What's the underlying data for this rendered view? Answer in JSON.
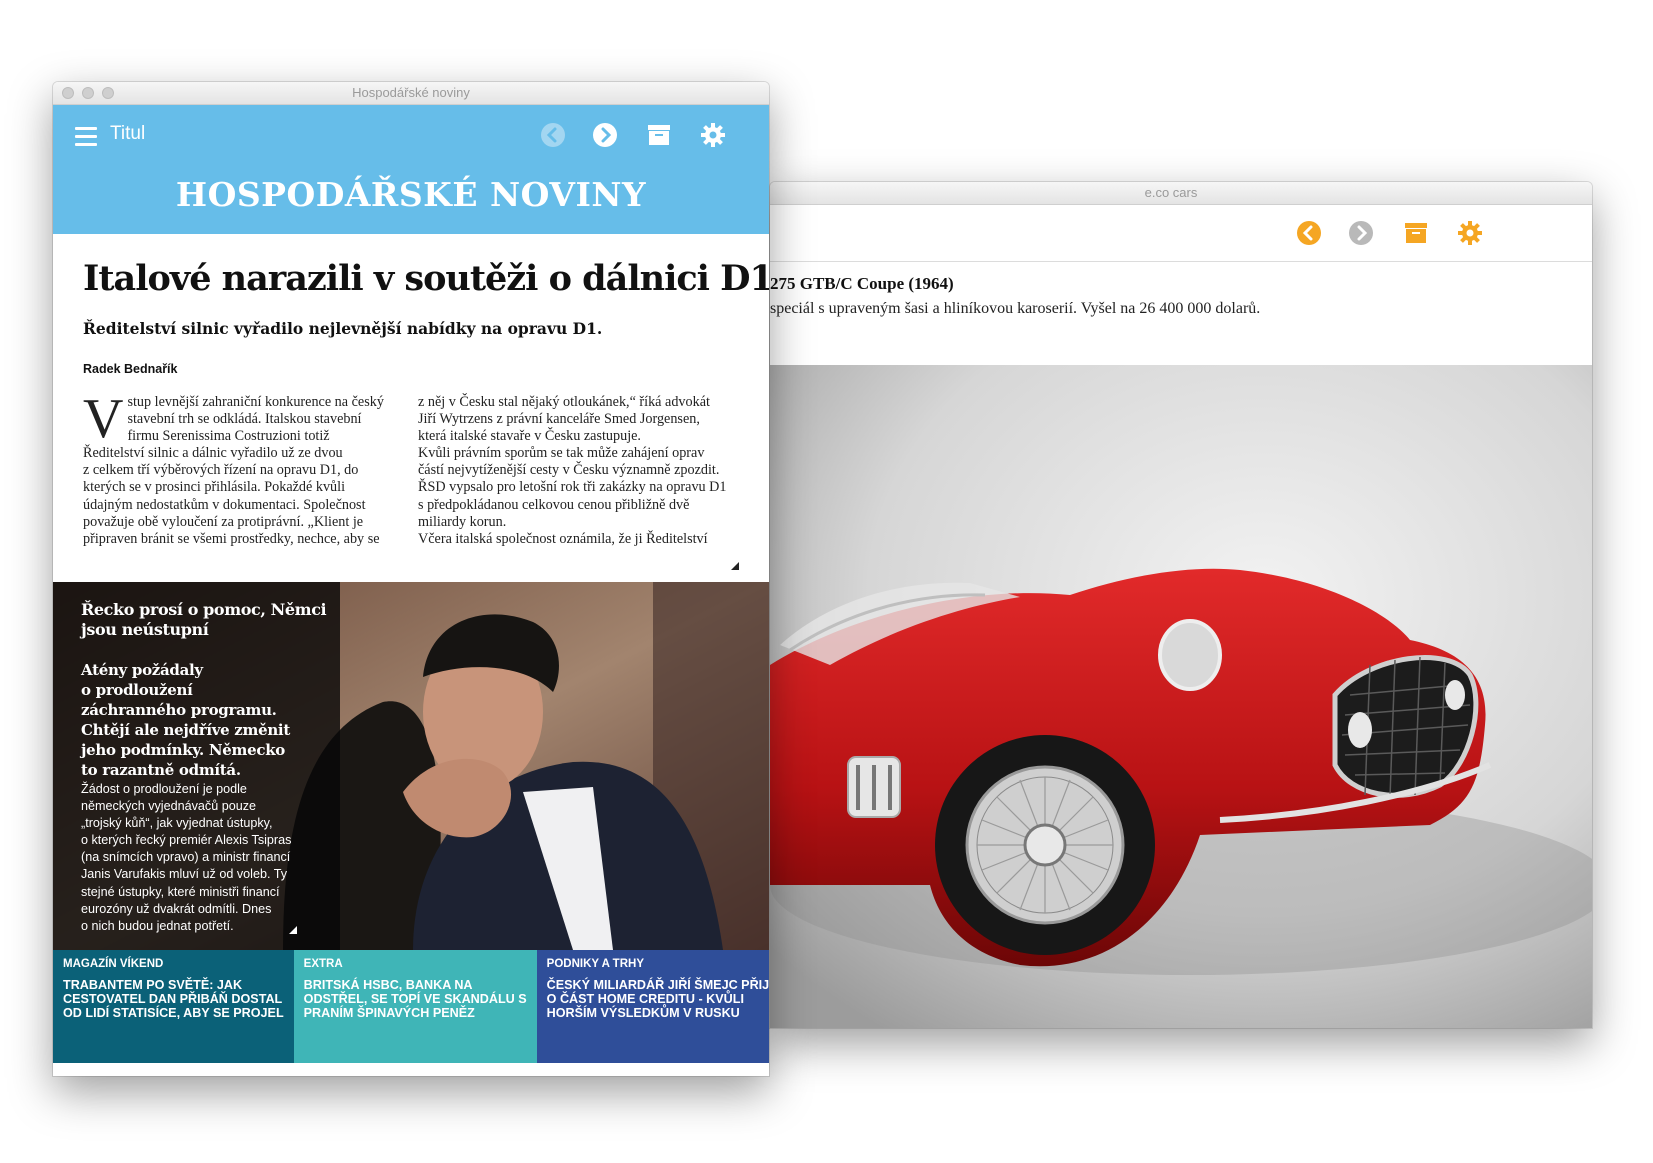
{
  "back_window": {
    "title": "e.co cars",
    "toolbar": {
      "back_icon": "chevron-left-circle-icon",
      "forward_icon": "chevron-right-circle-icon",
      "archive_icon": "archive-icon",
      "settings_icon": "gear-icon",
      "accent": "#f5a623"
    },
    "car_title": "275 GTB/C Coupe (1964)",
    "car_description": "speciál s upraveným šasi a hliníkovou karoserií. Vyšel na 26 400 000 dolarů."
  },
  "front_window": {
    "title": "Hospodářské noviny",
    "header": {
      "menu_label": "Titul",
      "masthead": "HOSPODÁŘSKÉ NOVINY",
      "bg_color": "#66bde9"
    },
    "article": {
      "headline": "Italové narazili v soutěži o dálnici D1",
      "subhead": "Ředitelství silnic vyřadilo nejlevnější nabídky na opravu D1.",
      "author": "Radek Bednařík",
      "dropcap": "V",
      "col1_lines": [
        "stup levnější zahraniční konkurence na český",
        "stavební trh se odkládá. Italskou stavební",
        "firmu Serenissima Costruzioni totiž",
        "Ředitelství silnic a dálnic vyřadilo už ze dvou",
        "z celkem tří výběrových řízení na opravu D1, do",
        "kterých se v prosinci přihlásila. Pokaždé kvůli",
        "údajným nedostatkům v dokumentaci. Společnost",
        "považuje obě vyloučení za protiprávní. „Klient je",
        "připraven bránit se všemi prostředky, nechce, aby se"
      ],
      "col2_lines": [
        "z něj v Česku stal nějaký otloukánek,“ říká advokát",
        "Jiří Wytrzens z právní kanceláře Smed Jorgensen,",
        "která italské stavaře v Česku zastupuje.",
        "Kvůli právním sporům se tak může zahájení oprav",
        "částí nejvytíženější cesty v Česku významně zpozdit.",
        "ŘSD vypsalo pro letošní rok tři zakázky na opravu D1",
        "s předpokládanou celkovou cenou přibližně dvě",
        "miliardy korun.",
        "Včera italská společnost oznámila, že ji Ředitelství"
      ]
    },
    "feature": {
      "title_lines": [
        "Řecko prosí o pomoc, Němci",
        "jsou neústupní"
      ],
      "lead_lines": [
        "Atény požádaly",
        "o prodloužení",
        "záchranného programu.",
        "Chtějí ale nejdříve změnit",
        "jeho podmínky. Německo",
        "to razantně odmítá."
      ],
      "body_lines": [
        "Žádost o prodloužení je podle",
        "německých vyjednávačů pouze",
        "„trojský kůň“, jak vyjednat ústupky,",
        "o kterých řecký premiér Alexis Tsipras",
        "(na snímcích vpravo) a ministr financí",
        "Janis Varufakis mluví už od voleb. Ty",
        "stejné ústupky, které ministři financí",
        "eurozóny už dvakrát odmítli. Dnes",
        "o nich budou jednat potřetí."
      ]
    },
    "tiles": [
      {
        "category": "MAGAZÍN VÍKEND",
        "title_lines": [
          "TRABANTEM PO SVĚTĚ: JAK",
          "CESTOVATEL DAN PŘIBÁŇ DOSTAL",
          "OD LIDÍ STATISÍCE, ABY SE PROJEL"
        ],
        "color": "#0b6178"
      },
      {
        "category": "EXTRA",
        "title_lines": [
          "BRITSKÁ HSBC, BANKA NA",
          "ODSTŘEL, SE TOPÍ VE SKANDÁLU S",
          "PRANÍM ŠPINAVÝCH PENĚZ"
        ],
        "color": "#3fb5b7"
      },
      {
        "category": "PODNIKY A TRHY",
        "title_lines": [
          "ČESKÝ MILIARDÁŘ JIŘÍ ŠMEJC PŘIJDE",
          "O ČÁST HOME CREDITU - KVŮLI",
          "HORŠÍM VÝSLEDKŮM V RUSKU"
        ],
        "color": "#2f4e99"
      }
    ]
  }
}
